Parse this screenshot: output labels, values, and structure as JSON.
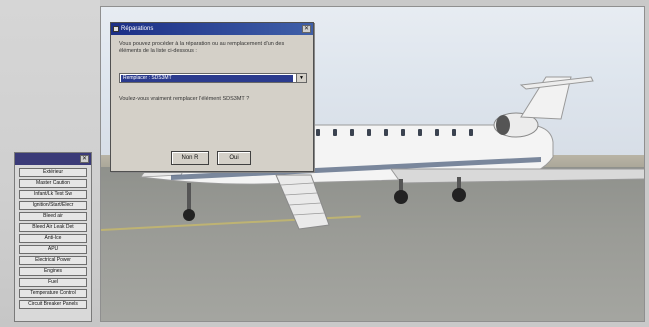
{
  "parts_panel": {
    "title": "",
    "close_glyph": "✕",
    "items": [
      "Extérieur",
      "Master Caution",
      "Infant/Lk Test Sw",
      "Ignition/Start/Elecr",
      "Bleed air",
      "Bleed Air Leak Det",
      "Anti-Ice",
      "APU",
      "Electrical Power",
      "Engines",
      "Fuel",
      "Temperature Control",
      "Circuit Breaker Panels"
    ]
  },
  "dialog": {
    "title": "Réparations",
    "close_glyph": "✕",
    "text1": "Vous pouvez procéder à la réparation ou au remplacement d'un des éléments de la liste ci-dessous :",
    "selected_option": "Remplacer : SDS3MT",
    "dropdown_arrow": "▼",
    "text2": "Voulez-vous vraiment remplacer l'élément SDS3MT ?",
    "no_label": "Non R",
    "yes_label": "Oui"
  },
  "colors": {
    "dialog_title_bar": "#1c2f86",
    "selection_highlight": "#2b3b8e",
    "panel_title_bar": "#3a3a78"
  }
}
